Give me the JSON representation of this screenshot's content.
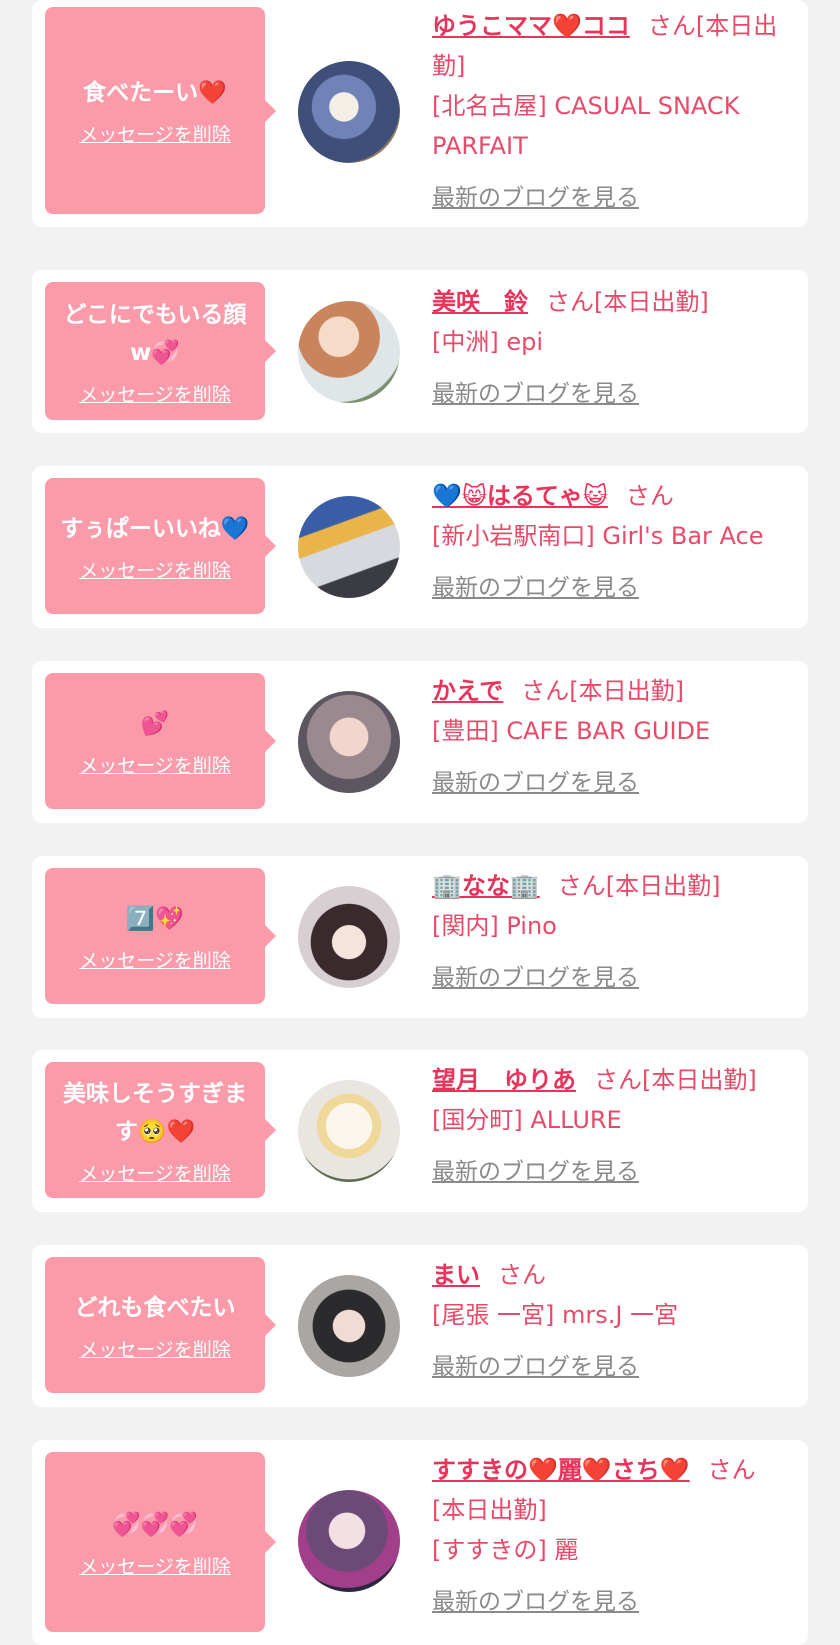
{
  "common": {
    "delete_label": "メッセージを削除",
    "blog_label": "最新のブログを見る",
    "san_label": "さん"
  },
  "items": [
    {
      "message": "食べたーい❤️",
      "name": "ゆうこママ❤️ココ",
      "status": "[本日出勤]",
      "shop": "[北名古屋] CASUAL SNACK PARFAIT",
      "avatar_icon": "avatar-photo-icon"
    },
    {
      "message": "どこにでもいる顔w💞",
      "name": "美咲　鈴",
      "status": "[本日出勤]",
      "shop": "[中洲] epi",
      "avatar_icon": "avatar-photo-icon"
    },
    {
      "message": "すぅぱーいいね💙",
      "name": "💙😸はるてゃ😺",
      "status": "",
      "shop": "[新小岩駅南口] Girl's Bar Ace",
      "avatar_icon": "avatar-photo-icon"
    },
    {
      "message": "💕",
      "name": "かえで",
      "status": "[本日出勤]",
      "shop": "[豊田] CAFE BAR GUIDE",
      "avatar_icon": "avatar-photo-icon"
    },
    {
      "message": "7️⃣💖",
      "name": "🏢なな🏢",
      "status": "[本日出勤]",
      "shop": "[関内] Pino",
      "avatar_icon": "avatar-photo-icon"
    },
    {
      "message": "美味しそうすぎます🥺❤️",
      "name": "望月　ゆりあ",
      "status": "[本日出勤]",
      "shop": "[国分町] ALLURE",
      "avatar_icon": "avatar-photo-icon"
    },
    {
      "message": "どれも食べたい",
      "name": "まい",
      "status": "",
      "shop": "[尾張 一宮] mrs.J 一宮",
      "avatar_icon": "avatar-photo-icon"
    },
    {
      "message": "💞💞💞",
      "name": "すすきの❤️麗❤️さち❤️",
      "status": "[本日出勤]",
      "shop": "[すすきの] 麗",
      "avatar_icon": "avatar-photo-icon"
    }
  ],
  "colors": {
    "background": "#f2f2f2",
    "card": "#ffffff",
    "bubble": "#fb9aa8",
    "name": "#e8345a",
    "text": "#e84b6a",
    "blog_link": "#8a8a8a"
  }
}
